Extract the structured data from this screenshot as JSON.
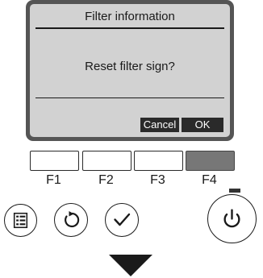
{
  "screen": {
    "title": "Filter information",
    "message": "Reset filter sign?",
    "softkeys": [
      "Cancel",
      "OK"
    ]
  },
  "function_keys": [
    {
      "label": "F1",
      "active": false
    },
    {
      "label": "F2",
      "active": false
    },
    {
      "label": "F3",
      "active": false
    },
    {
      "label": "F4",
      "active": true
    }
  ],
  "buttons": {
    "menu_icon": "menu-icon",
    "back_icon": "return-icon",
    "confirm_icon": "checkmark-icon",
    "power_icon": "power-icon"
  },
  "indicator": {
    "next_step_icon": "down-arrow-icon"
  },
  "colors": {
    "lcd_background": "#d2d2d2",
    "bezel": "#555555",
    "active_key": "#777777"
  }
}
